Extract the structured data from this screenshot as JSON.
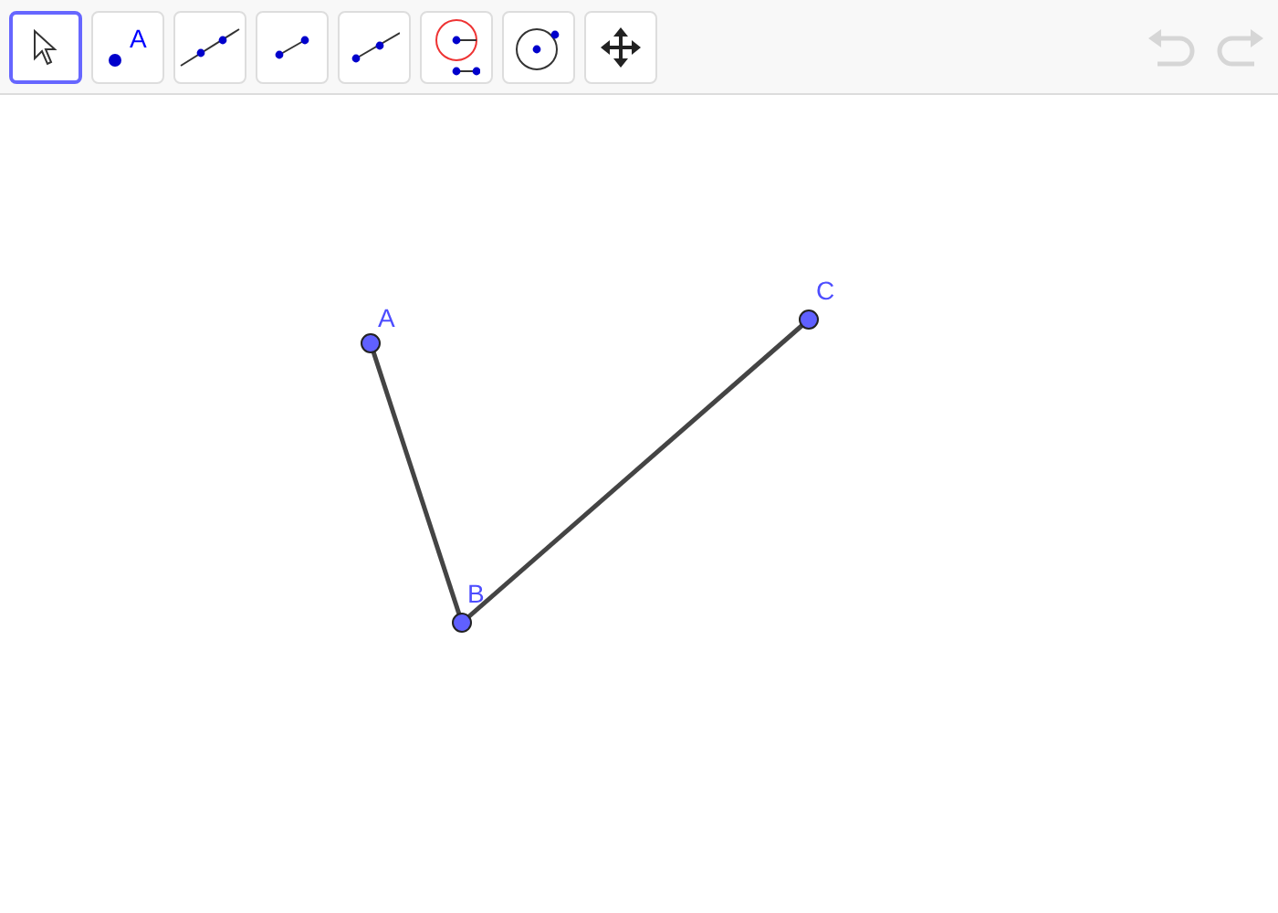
{
  "toolbar": {
    "tools": [
      {
        "kind": "move",
        "selected": true
      },
      {
        "kind": "point",
        "selected": false,
        "glyph": "A"
      },
      {
        "kind": "line",
        "selected": false
      },
      {
        "kind": "segment",
        "selected": false
      },
      {
        "kind": "ray",
        "selected": false
      },
      {
        "kind": "compass",
        "selected": false
      },
      {
        "kind": "circle",
        "selected": false
      },
      {
        "kind": "pan",
        "selected": false
      }
    ],
    "history": [
      {
        "kind": "undo",
        "disabled": true
      },
      {
        "kind": "redo",
        "disabled": true
      }
    ]
  },
  "canvas": {
    "points": [
      {
        "label": "A"
      },
      {
        "label": "B"
      },
      {
        "label": "C"
      }
    ]
  }
}
